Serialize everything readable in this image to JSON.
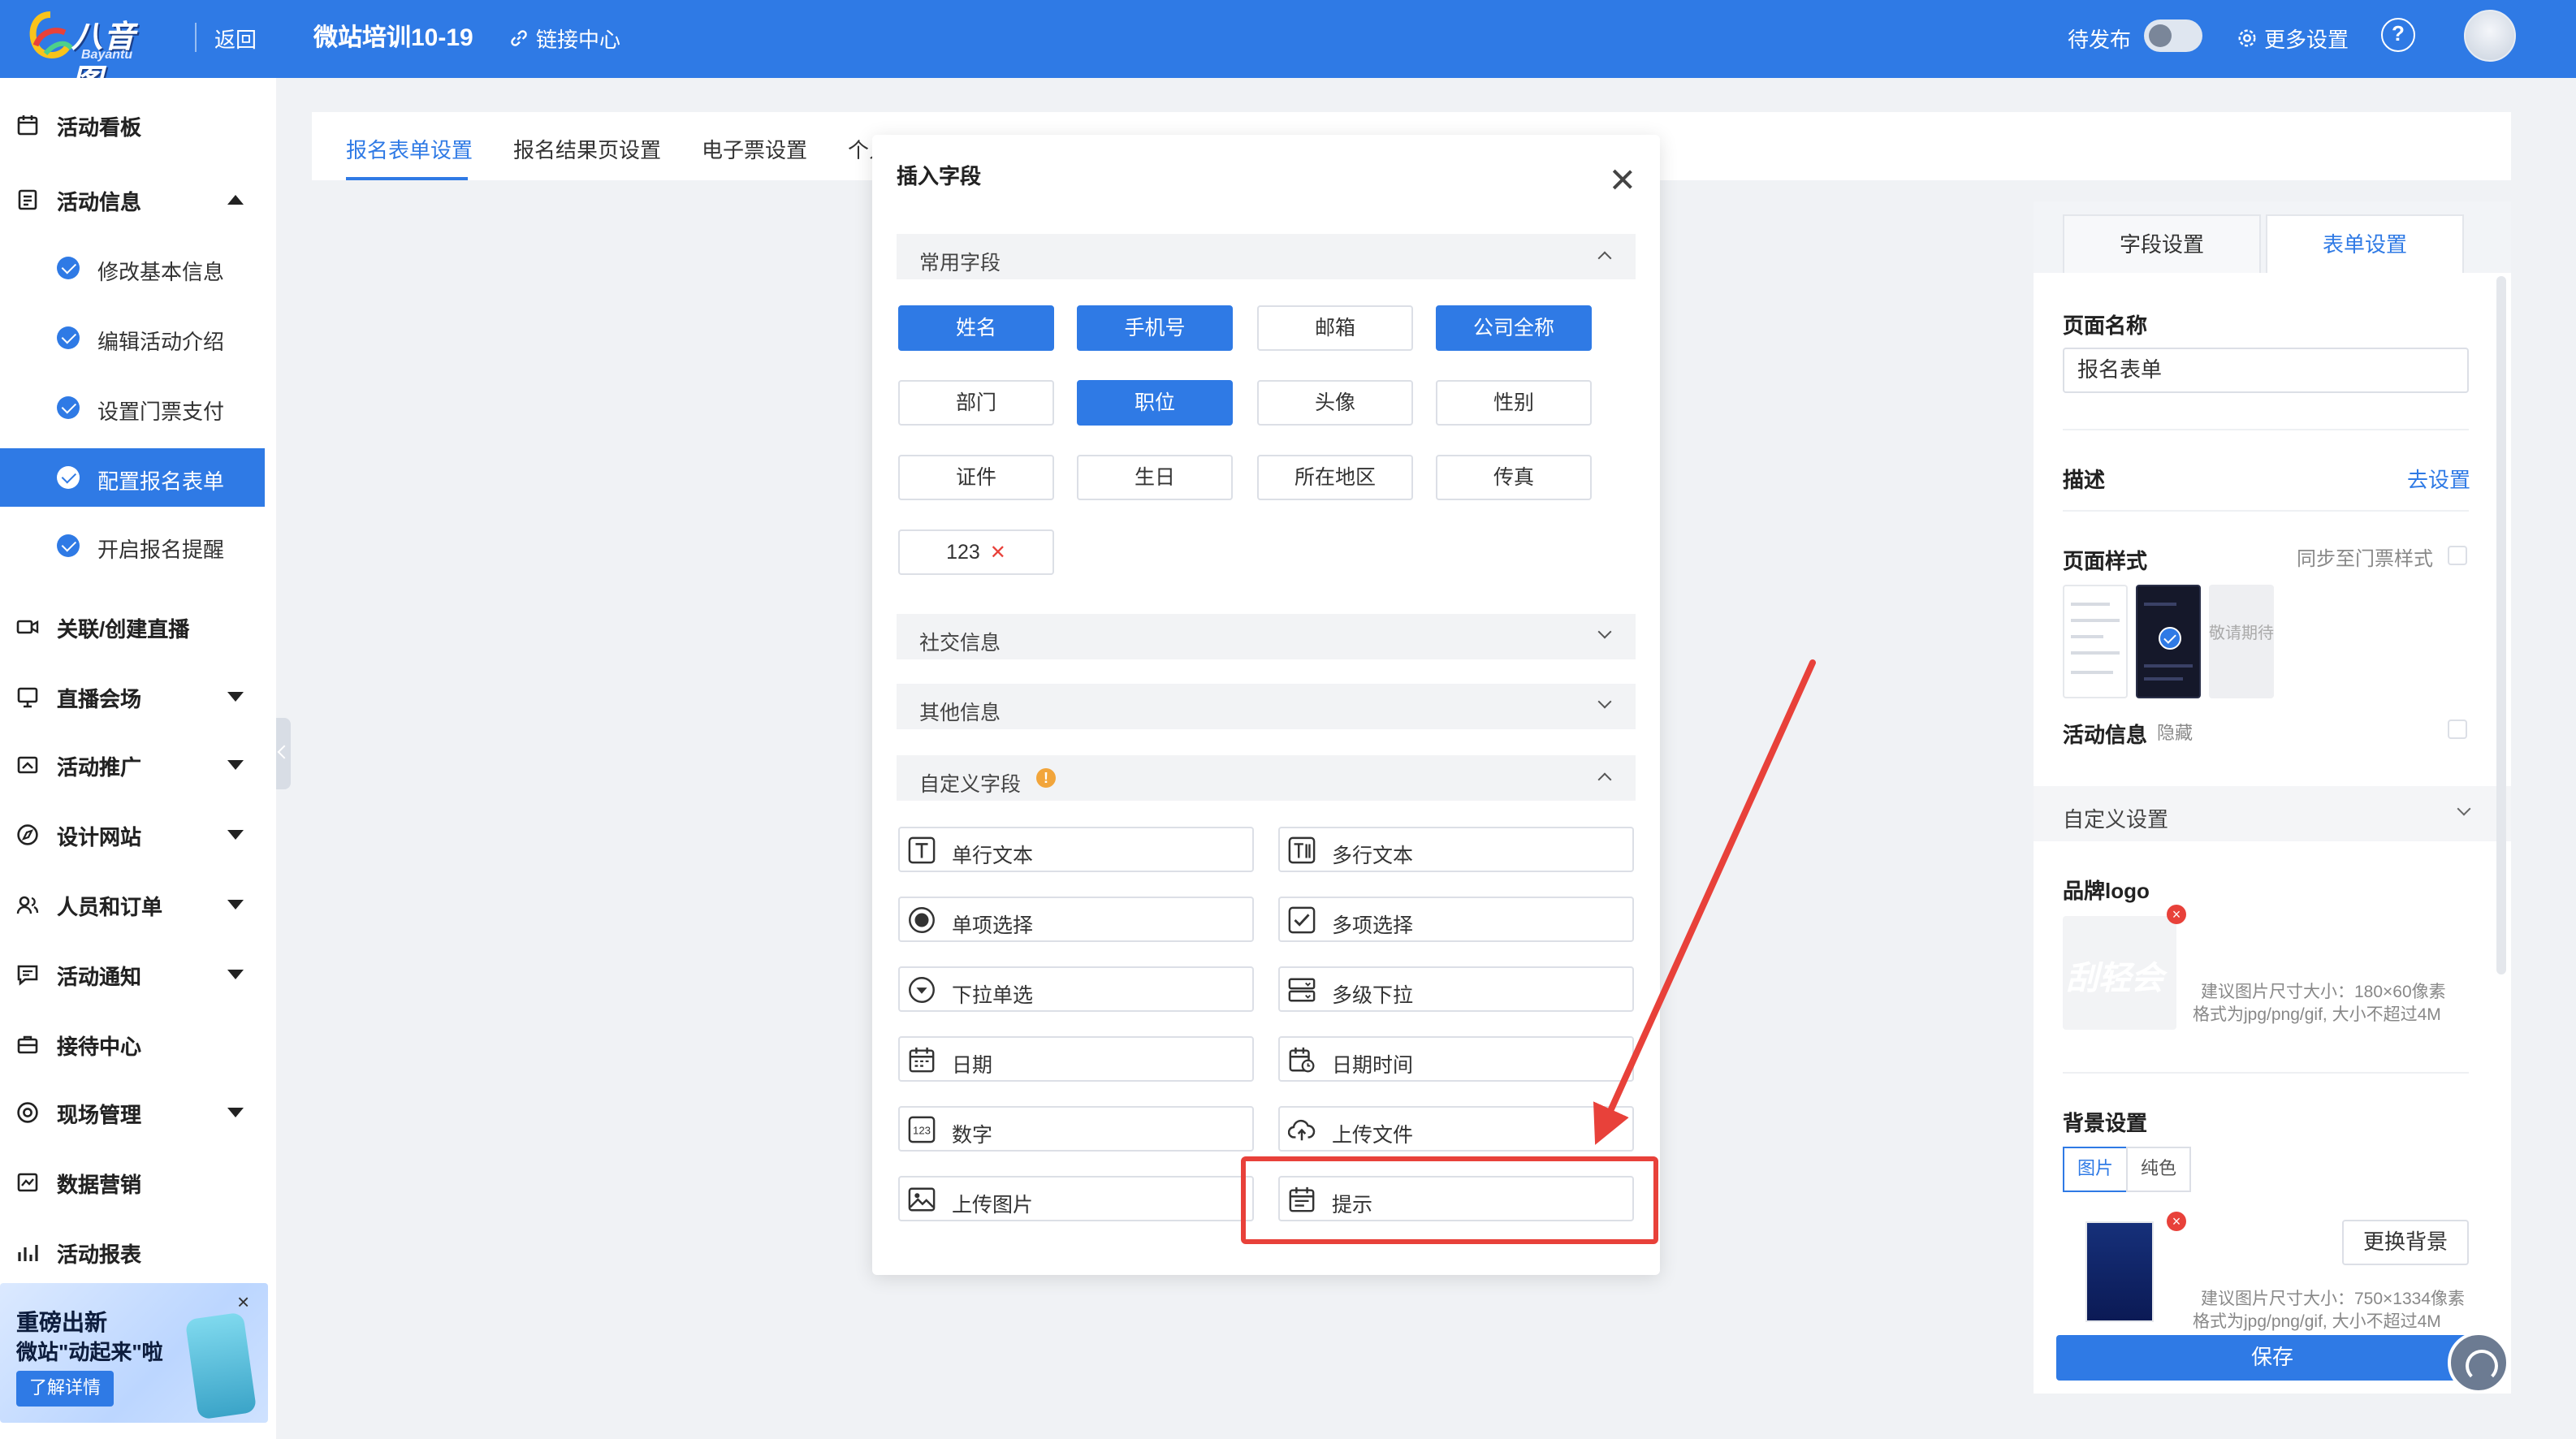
{
  "topbar": {
    "logo_text": "八音图",
    "logo_sub": "Bayantu",
    "back": "返回",
    "project_title": "微站培训10-19",
    "link_center": "链接中心",
    "status": "待发布",
    "more_settings": "更多设置",
    "help": "?"
  },
  "sidebar": {
    "items": [
      {
        "label": "活动看板",
        "icon": "calendar-icon"
      },
      {
        "label": "活动信息",
        "icon": "document-icon",
        "expanded": true
      },
      {
        "label": "关联/创建直播",
        "icon": "video-icon"
      },
      {
        "label": "直播会场",
        "icon": "screen-icon"
      },
      {
        "label": "活动推广",
        "icon": "share-icon"
      },
      {
        "label": "设计网站",
        "icon": "compass-icon"
      },
      {
        "label": "人员和订单",
        "icon": "users-icon"
      },
      {
        "label": "活动通知",
        "icon": "message-icon"
      },
      {
        "label": "接待中心",
        "icon": "briefcase-icon"
      },
      {
        "label": "现场管理",
        "icon": "target-icon"
      },
      {
        "label": "数据营销",
        "icon": "chart-icon"
      },
      {
        "label": "活动报表",
        "icon": "bar-chart-icon"
      }
    ],
    "sub_items": [
      {
        "label": "修改基本信息"
      },
      {
        "label": "编辑活动介绍"
      },
      {
        "label": "设置门票支付"
      },
      {
        "label": "配置报名表单",
        "active": true
      },
      {
        "label": "开启报名提醒"
      }
    ],
    "promo": {
      "line1": "重磅出新",
      "line2": "微站\"动起来\"啦",
      "button": "了解详情",
      "close": "×"
    }
  },
  "tabs": {
    "items": [
      "报名表单设置",
      "报名结果页设置",
      "电子票设置",
      "个人"
    ],
    "active_index": 0
  },
  "modal": {
    "title": "插入字段",
    "groups": {
      "common": {
        "title": "常用字段",
        "expanded": true
      },
      "social": {
        "title": "社交信息",
        "expanded": false
      },
      "other": {
        "title": "其他信息",
        "expanded": false
      },
      "custom": {
        "title": "自定义字段",
        "expanded": true,
        "info": "!"
      }
    },
    "common_fields": [
      {
        "label": "姓名",
        "selected": true
      },
      {
        "label": "手机号",
        "selected": true
      },
      {
        "label": "邮箱",
        "selected": false
      },
      {
        "label": "公司全称",
        "selected": true
      },
      {
        "label": "部门",
        "selected": false
      },
      {
        "label": "职位",
        "selected": true
      },
      {
        "label": "头像",
        "selected": false
      },
      {
        "label": "性别",
        "selected": false
      },
      {
        "label": "证件",
        "selected": false
      },
      {
        "label": "生日",
        "selected": false
      },
      {
        "label": "所在地区",
        "selected": false
      },
      {
        "label": "传真",
        "selected": false
      },
      {
        "label": "123",
        "selected": false,
        "removable": true
      }
    ],
    "custom_fields": [
      {
        "label": "单行文本",
        "icon": "text-field-icon"
      },
      {
        "label": "多行文本",
        "icon": "textarea-icon"
      },
      {
        "label": "单项选择",
        "icon": "radio-icon"
      },
      {
        "label": "多项选择",
        "icon": "checkbox-icon"
      },
      {
        "label": "下拉单选",
        "icon": "dropdown-icon"
      },
      {
        "label": "多级下拉",
        "icon": "cascader-icon"
      },
      {
        "label": "日期",
        "icon": "calendar-icon"
      },
      {
        "label": "日期时间",
        "icon": "datetime-icon"
      },
      {
        "label": "数字",
        "icon": "number-icon"
      },
      {
        "label": "上传文件",
        "icon": "upload-cloud-icon"
      },
      {
        "label": "上传图片",
        "icon": "image-icon"
      },
      {
        "label": "提示",
        "icon": "notice-icon"
      }
    ]
  },
  "right_panel": {
    "tabs": [
      "字段设置",
      "表单设置"
    ],
    "active_tab": 1,
    "page_name_label": "页面名称",
    "page_name_value": "报名表单",
    "desc_label": "描述",
    "desc_link": "去设置",
    "style_label": "页面样式",
    "sync_label": "同步至门票样式",
    "coming_soon": "敬请期待",
    "activity_info_label": "活动信息",
    "activity_info_hide": "隐藏",
    "custom_settings": "自定义设置",
    "brand_logo_label": "品牌logo",
    "brand_logo_ghost": "刮轻会",
    "logo_tip_1": "建议图片尺寸大小：180×60像素",
    "logo_tip_2": "格式为jpg/png/gif, 大小不超过4M",
    "bg_label": "背景设置",
    "bg_options": [
      "图片",
      "纯色"
    ],
    "bg_active": 0,
    "change_bg": "更换背景",
    "bg_tip_1": "建议图片尺寸大小：750×1334像素",
    "bg_tip_2": "格式为jpg/png/gif, 大小不超过4M",
    "save": "保存"
  },
  "colors": {
    "primary": "#2f7ae5",
    "danger": "#e8413a",
    "warning": "#f2a53b"
  }
}
